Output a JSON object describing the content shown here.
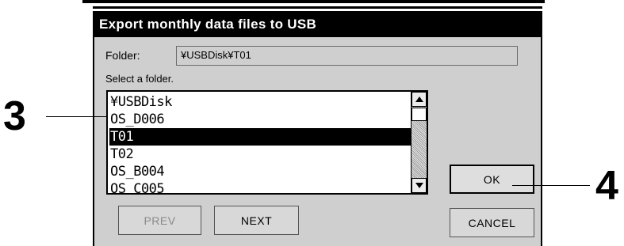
{
  "dialog": {
    "title": "Export monthly data files to USB",
    "folder_label": "Folder:",
    "folder_value": "¥USBDisk¥T01",
    "instruction": "Select a folder.",
    "list_items": [
      "¥USBDisk",
      "OS_D006",
      "T01",
      "T02",
      "OS_B004",
      "OS_C005"
    ],
    "selected_index": 2
  },
  "buttons": {
    "prev": "PREV",
    "next": "NEXT",
    "ok": "OK",
    "cancel": "CANCEL"
  },
  "callouts": {
    "left": "3",
    "right": "4"
  },
  "icons": {
    "scroll_up": "triangle-up-icon",
    "scroll_down": "triangle-down-icon"
  }
}
